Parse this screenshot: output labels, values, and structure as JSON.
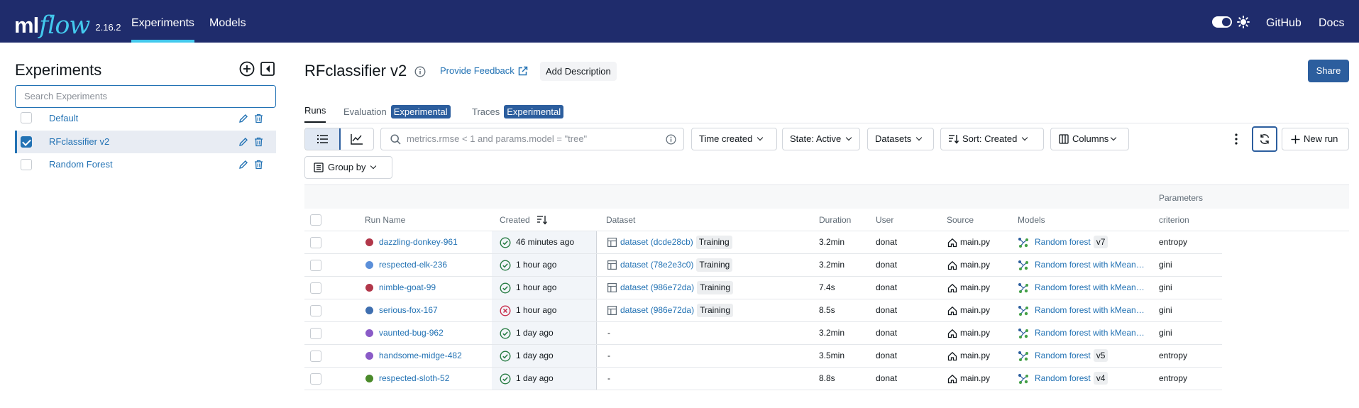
{
  "header": {
    "logo_ml": "ml",
    "logo_flow": "flow",
    "version": "2.16.2",
    "nav": [
      "Experiments",
      "Models"
    ],
    "links": [
      "GitHub",
      "Docs"
    ]
  },
  "sidebar": {
    "title": "Experiments",
    "search_placeholder": "Search Experiments",
    "experiments": [
      {
        "name": "Default",
        "checked": false
      },
      {
        "name": "RFclassifier v2",
        "checked": true
      },
      {
        "name": "Random Forest",
        "checked": false
      }
    ]
  },
  "main": {
    "title": "RFclassifier v2",
    "feedback": "Provide Feedback",
    "add_description": "Add Description",
    "share": "Share",
    "tabs": {
      "runs": "Runs",
      "evaluation": "Evaluation",
      "traces": "Traces",
      "badge": "Experimental"
    },
    "toolbar": {
      "search_placeholder": "metrics.rmse < 1 and params.model = \"tree\"",
      "time_created": "Time created",
      "state": "State: Active",
      "datasets": "Datasets",
      "sort": "Sort: Created",
      "columns": "Columns",
      "new_run": "New run",
      "group_by": "Group by"
    }
  },
  "table": {
    "group_header": "Parameters",
    "columns": {
      "run_name": "Run Name",
      "created": "Created",
      "dataset": "Dataset",
      "duration": "Duration",
      "user": "User",
      "source": "Source",
      "models": "Models",
      "criterion": "criterion"
    },
    "rows": [
      {
        "name": "dazzling-donkey-961",
        "color": "#b1374a",
        "status": "ok",
        "created": "46 minutes ago",
        "dataset": "dataset (dcde28cb)",
        "dataset_tag": "Training",
        "duration": "3.2min",
        "user": "donat",
        "source": "main.py",
        "model": "Random forest",
        "model_version": "v7",
        "criterion": "entropy"
      },
      {
        "name": "respected-elk-236",
        "color": "#5b8fd9",
        "status": "ok",
        "created": "1 hour ago",
        "dataset": "dataset (78e2e3c0)",
        "dataset_tag": "Training",
        "duration": "3.2min",
        "user": "donat",
        "source": "main.py",
        "model": "Random forest with kMean…",
        "model_version": "",
        "criterion": "gini"
      },
      {
        "name": "nimble-goat-99",
        "color": "#b1374a",
        "status": "ok",
        "created": "1 hour ago",
        "dataset": "dataset (986e72da)",
        "dataset_tag": "Training",
        "duration": "7.4s",
        "user": "donat",
        "source": "main.py",
        "model": "Random forest with kMean…",
        "model_version": "",
        "criterion": "gini"
      },
      {
        "name": "serious-fox-167",
        "color": "#3f6fb0",
        "status": "error",
        "created": "1 hour ago",
        "dataset": "dataset (986e72da)",
        "dataset_tag": "Training",
        "duration": "8.5s",
        "user": "donat",
        "source": "main.py",
        "model": "Random forest with kMean…",
        "model_version": "",
        "criterion": "gini"
      },
      {
        "name": "vaunted-bug-962",
        "color": "#8a5bc7",
        "status": "ok",
        "created": "1 day ago",
        "dataset": "-",
        "dataset_tag": "",
        "duration": "3.2min",
        "user": "donat",
        "source": "main.py",
        "model": "Random forest with kMean…",
        "model_version": "",
        "criterion": "gini"
      },
      {
        "name": "handsome-midge-482",
        "color": "#8a5bc7",
        "status": "ok",
        "created": "1 day ago",
        "dataset": "-",
        "dataset_tag": "",
        "duration": "3.5min",
        "user": "donat",
        "source": "main.py",
        "model": "Random forest",
        "model_version": "v5",
        "criterion": "entropy"
      },
      {
        "name": "respected-sloth-52",
        "color": "#4a8a2a",
        "status": "ok",
        "created": "1 day ago",
        "dataset": "-",
        "dataset_tag": "",
        "duration": "8.8s",
        "user": "donat",
        "source": "main.py",
        "model": "Random forest",
        "model_version": "v4",
        "criterion": "entropy"
      }
    ]
  }
}
